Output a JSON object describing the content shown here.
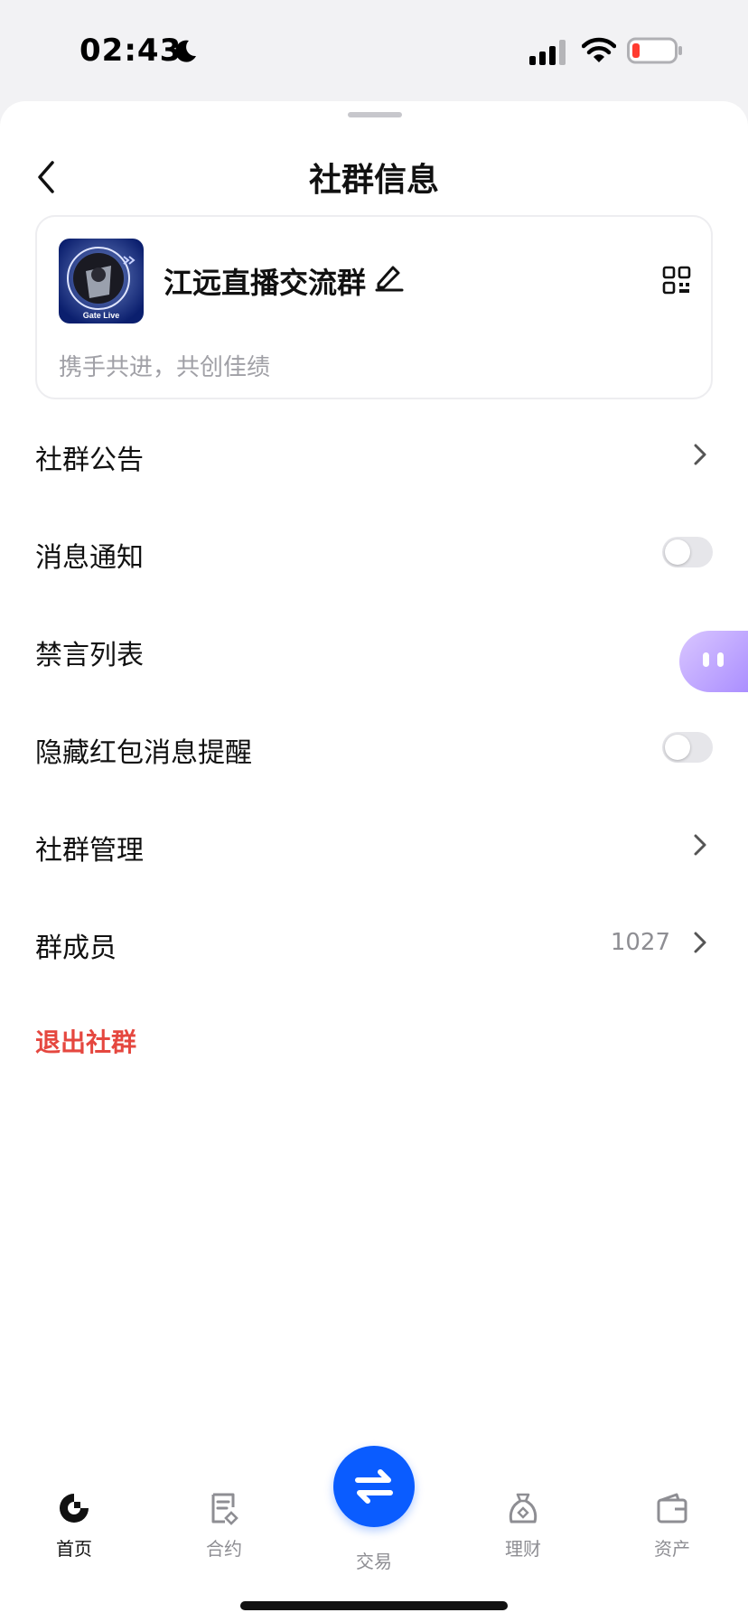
{
  "status_bar": {
    "time": "02:43",
    "icons": [
      "moon-icon",
      "signal-icon",
      "wifi-icon",
      "battery-icon"
    ]
  },
  "nav": {
    "title": "社群信息",
    "back_icon": "chevron-left-icon"
  },
  "group": {
    "name": "江远直播交流群",
    "description": "携手共进，共创佳绩",
    "avatar_caption": "Gate Live",
    "edit_icon": "pencil-icon",
    "qr_icon": "qr-code-icon"
  },
  "rows": [
    {
      "label": "社群公告",
      "type": "chevron"
    },
    {
      "label": "消息通知",
      "type": "toggle",
      "on": false
    },
    {
      "label": "禁言列表",
      "type": "chevron"
    },
    {
      "label": "隐藏红包消息提醒",
      "type": "toggle",
      "on": false
    },
    {
      "label": "社群管理",
      "type": "chevron"
    },
    {
      "label": "群成员",
      "type": "chevron",
      "value": "1027"
    }
  ],
  "exit_label": "退出社群",
  "tabbar": {
    "items": [
      {
        "label": "首页",
        "icon": "gate-home-icon",
        "active": true
      },
      {
        "label": "合约",
        "icon": "contract-icon",
        "active": false
      },
      {
        "label": "交易",
        "icon": "swap-arrows-icon",
        "active": false
      },
      {
        "label": "理财",
        "icon": "wealth-bag-icon",
        "active": false
      },
      {
        "label": "资产",
        "icon": "wallet-icon",
        "active": false
      }
    ]
  },
  "colors": {
    "accent": "#0A5CFF",
    "danger": "#E5473F",
    "muted": "#8E8E93",
    "assistant": "#A88BFF"
  }
}
